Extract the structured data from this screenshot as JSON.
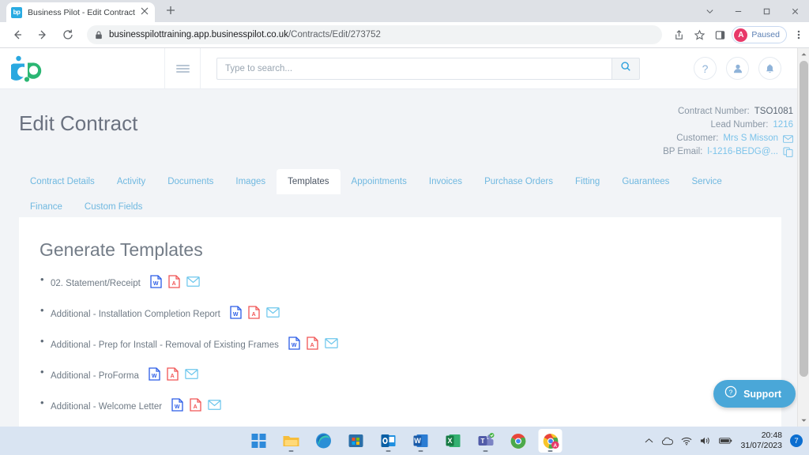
{
  "browser": {
    "tab": {
      "title": "Business Pilot - Edit Contract",
      "favicon_label": "bp",
      "close_icon": "close-icon"
    },
    "new_tab_label": "+",
    "window_controls": [
      "tab-search-icon",
      "minimize-icon",
      "maximize-icon",
      "close-icon"
    ],
    "nav": {
      "back": "back-icon",
      "forward": "forward-icon",
      "reload": "reload-icon"
    },
    "omnibox": {
      "lock_icon": "lock-icon",
      "host": "businesspilottraining.app.businesspilot.co.uk",
      "path": "/Contracts/Edit/273752"
    },
    "toolbar_icons": [
      "share-icon",
      "bookmark-star-icon",
      "side-panel-icon"
    ],
    "profile": {
      "initial": "A",
      "label": "Paused"
    },
    "menu_icon": "kebab-menu-icon"
  },
  "app_header": {
    "logo_name": "business-pilot-logo",
    "menu_icon": "hamburger-menu-icon",
    "search": {
      "placeholder": "Type to search...",
      "value": "",
      "button_icon": "search-icon"
    },
    "icons": [
      {
        "name": "help-icon",
        "glyph": "?"
      },
      {
        "name": "user-account-icon",
        "glyph": "person"
      },
      {
        "name": "notifications-bell-icon",
        "glyph": "bell"
      }
    ]
  },
  "page": {
    "title": "Edit Contract",
    "contract_info": [
      {
        "label": "Contract Number:",
        "value": "TSO1081",
        "style": "plain",
        "icon": null
      },
      {
        "label": "Lead Number:",
        "value": "1216",
        "style": "link",
        "icon": null
      },
      {
        "label": "Customer:",
        "value": "Mrs S Misson",
        "style": "link",
        "icon": "envelope-icon"
      },
      {
        "label": "BP Email:",
        "value": "l-1216-BEDG@...",
        "style": "link",
        "icon": "copy-icon"
      }
    ]
  },
  "tabs": [
    {
      "label": "Contract Details",
      "active": false
    },
    {
      "label": "Activity",
      "active": false
    },
    {
      "label": "Documents",
      "active": false
    },
    {
      "label": "Images",
      "active": false
    },
    {
      "label": "Templates",
      "active": true
    },
    {
      "label": "Appointments",
      "active": false
    },
    {
      "label": "Invoices",
      "active": false
    },
    {
      "label": "Purchase Orders",
      "active": false
    },
    {
      "label": "Fitting",
      "active": false
    },
    {
      "label": "Guarantees",
      "active": false
    },
    {
      "label": "Service",
      "active": false
    },
    {
      "label": "Finance",
      "active": false
    },
    {
      "label": "Custom Fields",
      "active": false
    }
  ],
  "content": {
    "heading": "Generate Templates",
    "templates": [
      {
        "label": "02. Statement/Receipt",
        "actions": [
          "word-doc-icon",
          "pdf-doc-icon",
          "email-envelope-icon"
        ]
      },
      {
        "label": "Additional - Installation Completion Report",
        "actions": [
          "word-doc-icon",
          "pdf-doc-icon",
          "email-envelope-icon"
        ]
      },
      {
        "label": "Additional - Prep for Install - Removal of Existing Frames",
        "actions": [
          "word-doc-icon",
          "pdf-doc-icon",
          "email-envelope-icon"
        ]
      },
      {
        "label": "Additional - ProForma",
        "actions": [
          "word-doc-icon",
          "pdf-doc-icon",
          "email-envelope-icon"
        ]
      },
      {
        "label": "Additional - Welcome Letter",
        "actions": [
          "word-doc-icon",
          "pdf-doc-icon",
          "email-envelope-icon"
        ]
      }
    ]
  },
  "support_widget": {
    "label": "Support",
    "icon": "question-circle-icon"
  },
  "taskbar": {
    "apps": [
      {
        "name": "start-button",
        "running": false
      },
      {
        "name": "file-explorer",
        "running": true
      },
      {
        "name": "microsoft-edge",
        "running": false
      },
      {
        "name": "microsoft-store",
        "running": false
      },
      {
        "name": "outlook",
        "running": true
      },
      {
        "name": "word",
        "running": true
      },
      {
        "name": "excel",
        "running": false
      },
      {
        "name": "teams",
        "running": true
      },
      {
        "name": "chrome",
        "running": false
      },
      {
        "name": "chrome-active",
        "running": true,
        "active": true
      }
    ],
    "tray": {
      "overflow_icon": "chevron-up-icon",
      "cloud_icon": "onedrive-icon",
      "wifi_icon": "wifi-icon",
      "volume_icon": "speaker-icon",
      "battery_icon": "battery-icon",
      "time": "20:48",
      "date": "31/07/2023",
      "notification_count": "7"
    }
  },
  "colors": {
    "brand_blue": "#2aa8e0",
    "brand_teal": "#2bb673",
    "link": "#7cc3ea",
    "support_bg": "#4aa7d8",
    "word_blue": "#2b5ce6",
    "pdf_red": "#f05555"
  }
}
